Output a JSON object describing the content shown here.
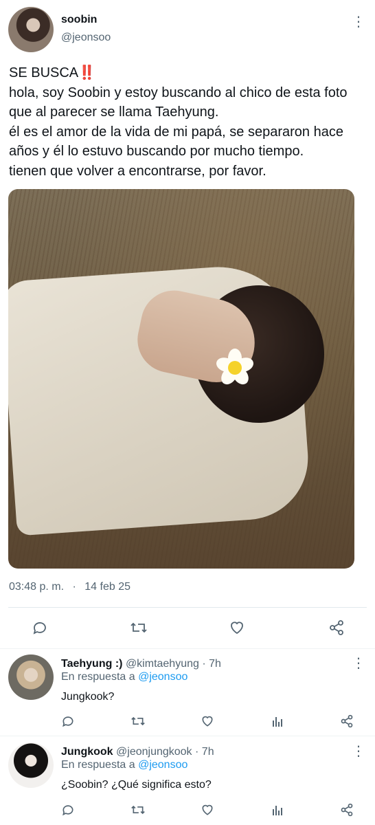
{
  "tweet": {
    "author_name": "soobin",
    "author_handle": "@jeonsoo",
    "lines": [
      "SE BUSCA‼️",
      "hola, soy Soobin y estoy buscando al chico de esta foto",
      "que al parecer se llama Taehyung.",
      "él es el amor de la vida de mi papá, se separaron hace",
      "años y él lo estuvo buscando por mucho tiempo.",
      "tienen que volver a encontrarse, por favor."
    ],
    "time": "03:48 p. m.",
    "separator": "·",
    "date": "14 feb 25",
    "actions": [
      "reply-icon",
      "retweet-icon",
      "like-icon",
      "share-icon"
    ]
  },
  "replies": [
    {
      "name": "Taehyung :)",
      "handle": "@kimtaehyung",
      "age": "· 7h",
      "reply_prefix": "En respuesta a",
      "reply_mention": "@jeonsoo",
      "text": "Jungkook?"
    },
    {
      "name": "Jungkook",
      "handle": "@jeonjungkook",
      "age": "· 7h",
      "reply_prefix": "En respuesta a",
      "reply_mention": "@jeonsoo",
      "text": "¿Soobin? ¿Qué significa esto?"
    }
  ],
  "more_glyph": "⋮",
  "colors": {
    "text": "#0f1419",
    "secondary": "#536471",
    "link": "#1d9bf0",
    "divider": "#e1e8ed"
  }
}
